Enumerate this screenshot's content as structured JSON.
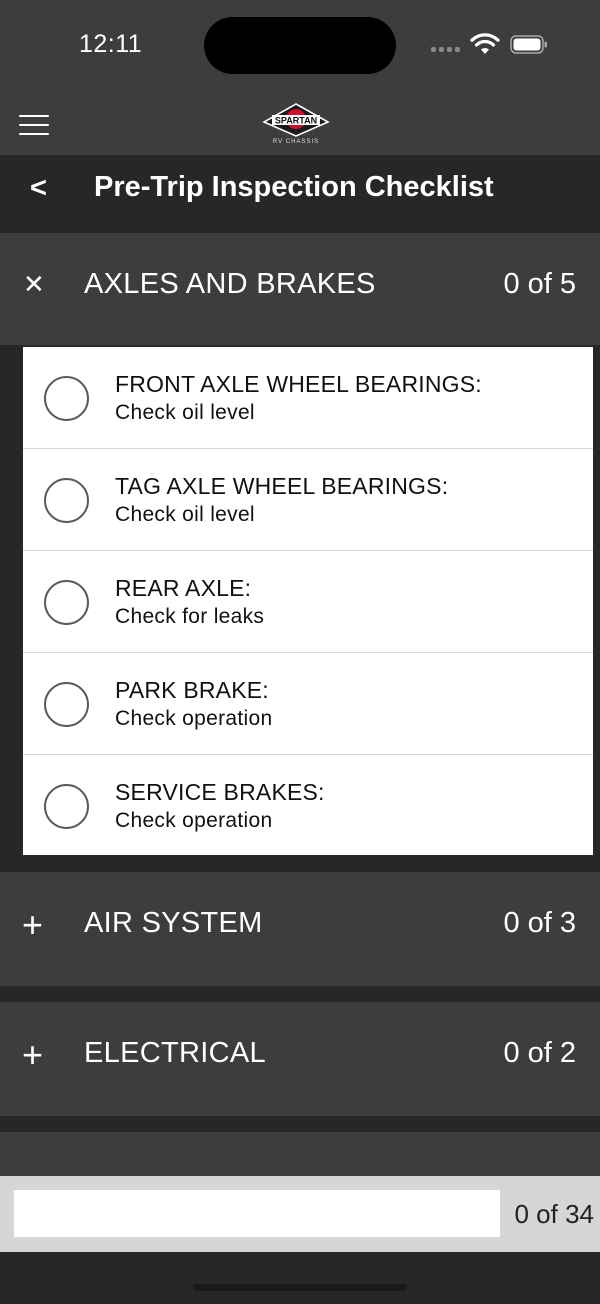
{
  "status_bar": {
    "time": "12:11"
  },
  "header": {
    "logo_text": "SPARTAN",
    "logo_subtext": "RV CHASSIS"
  },
  "title_bar": {
    "back_label": "<",
    "title": "Pre-Trip Inspection Checklist"
  },
  "sections": [
    {
      "icon": "close-icon",
      "icon_glyph": "✕",
      "title": "AXLES AND BRAKES",
      "count": "0 of 5",
      "expanded": true,
      "items": [
        {
          "title": "FRONT AXLE WHEEL BEARINGS:",
          "subtitle": "Check oil level",
          "checked": false
        },
        {
          "title": "TAG AXLE WHEEL BEARINGS:",
          "subtitle": "Check oil level",
          "checked": false
        },
        {
          "title": "REAR AXLE:",
          "subtitle": "Check for leaks",
          "checked": false
        },
        {
          "title": "PARK BRAKE:",
          "subtitle": "Check operation",
          "checked": false
        },
        {
          "title": "SERVICE BRAKES:",
          "subtitle": "Check operation",
          "checked": false
        }
      ]
    },
    {
      "icon": "plus-icon",
      "icon_glyph": "+",
      "title": "AIR SYSTEM",
      "count": "0 of 3",
      "expanded": false
    },
    {
      "icon": "plus-icon",
      "icon_glyph": "+",
      "title": "ELECTRICAL",
      "count": "0 of 2",
      "expanded": false
    }
  ],
  "progress": {
    "text": "0 of 34",
    "completed": 0,
    "total": 34
  },
  "colors": {
    "brand": "#c8102e",
    "header_bg": "#3d3d3d",
    "background": "#272727"
  }
}
